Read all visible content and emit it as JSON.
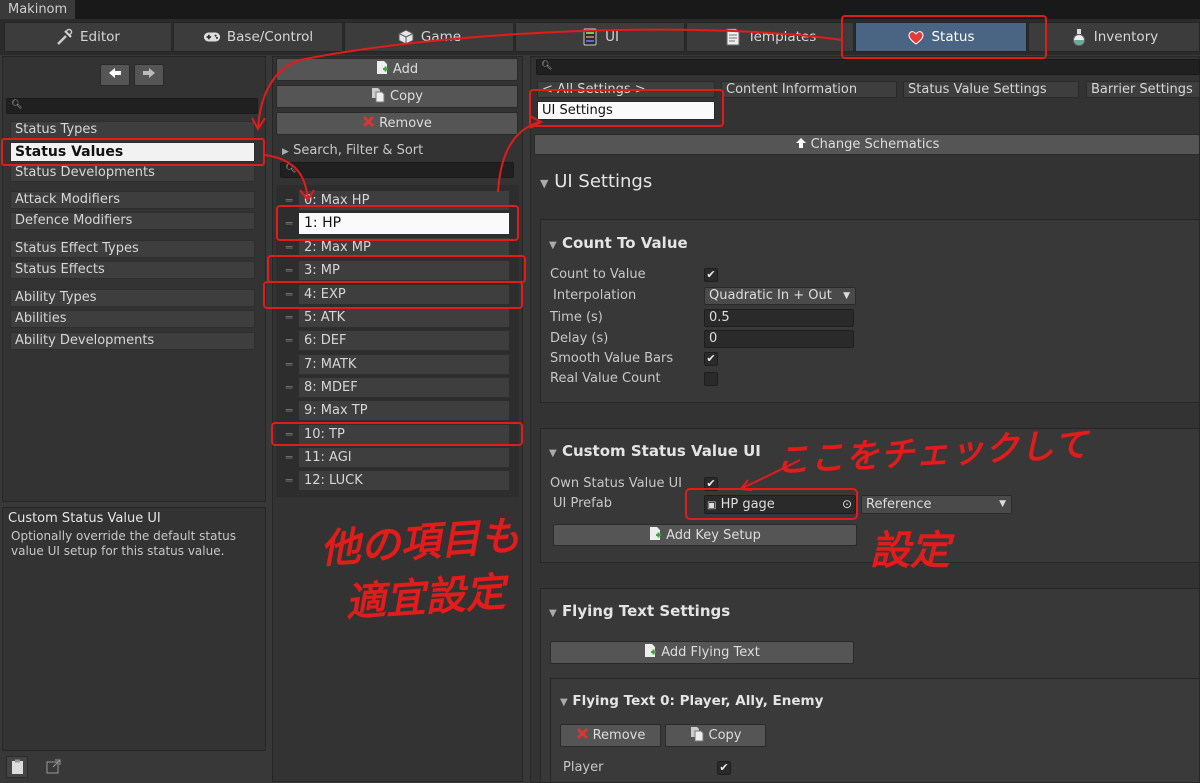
{
  "window": {
    "title": "Makinom"
  },
  "tabs": [
    {
      "label": "Editor",
      "icon": "tools-icon"
    },
    {
      "label": "Base/Control",
      "icon": "gamepad-icon"
    },
    {
      "label": "Game",
      "icon": "cube-icon"
    },
    {
      "label": "UI",
      "icon": "ui-icon"
    },
    {
      "label": "Templates",
      "icon": "document-icon"
    },
    {
      "label": "Status",
      "icon": "heart-icon"
    },
    {
      "label": "Inventory",
      "icon": "potion-icon"
    }
  ],
  "sidebar": {
    "items": [
      "Status Types",
      "Status Values",
      "Status Developments",
      "Attack Modifiers",
      "Defence Modifiers",
      "Status Effect Types",
      "Status Effects",
      "Ability Types",
      "Abilities",
      "Ability Developments"
    ],
    "help_title": "Custom Status Value UI",
    "help_text": "Optionally override the default status value UI setup for this status value."
  },
  "list_panel": {
    "add": "Add",
    "copy": "Copy",
    "remove": "Remove",
    "search_filter": "Search, Filter & Sort",
    "items": [
      "0: Max HP",
      "1: HP",
      "2: Max MP",
      "3: MP",
      "4: EXP",
      "5: ATK",
      "6: DEF",
      "7: MATK",
      "8: MDEF",
      "9: Max TP",
      "10: TP",
      "11: AGI",
      "12: LUCK"
    ]
  },
  "settings": {
    "subtabs": [
      "< All Settings >",
      "Content Information",
      "Status Value Settings",
      "Barrier Settings",
      "UI Settings"
    ],
    "change_schematics": "Change Schematics",
    "ui_settings": "UI Settings",
    "count_to_value": {
      "title": "Count To Value",
      "count_label": "Count to Value",
      "interpolation_label": "Interpolation",
      "interpolation_value": "Quadratic In + Out",
      "time_label": "Time (s)",
      "time_value": "0.5",
      "delay_label": "Delay (s)",
      "delay_value": "0",
      "smooth_label": "Smooth Value Bars",
      "real_label": "Real Value Count"
    },
    "custom_ui": {
      "title": "Custom Status Value UI",
      "own_label": "Own Status Value UI",
      "prefab_label": "UI Prefab",
      "prefab_value": "HP gage",
      "reference": "Reference",
      "add_key": "Add Key Setup"
    },
    "flying": {
      "title": "Flying Text Settings",
      "add": "Add Flying Text",
      "item_title": "Flying Text 0: Player, Ally, Enemy",
      "remove": "Remove",
      "copy": "Copy",
      "player": "Player"
    }
  },
  "annotations": {
    "check_here": "ここをチェックして",
    "set": "設定",
    "others_line1": "他の項目も",
    "others_line2": "適宜設定"
  },
  "colors": {
    "accent": "#4a6484",
    "annotation": "#e21b1b"
  }
}
